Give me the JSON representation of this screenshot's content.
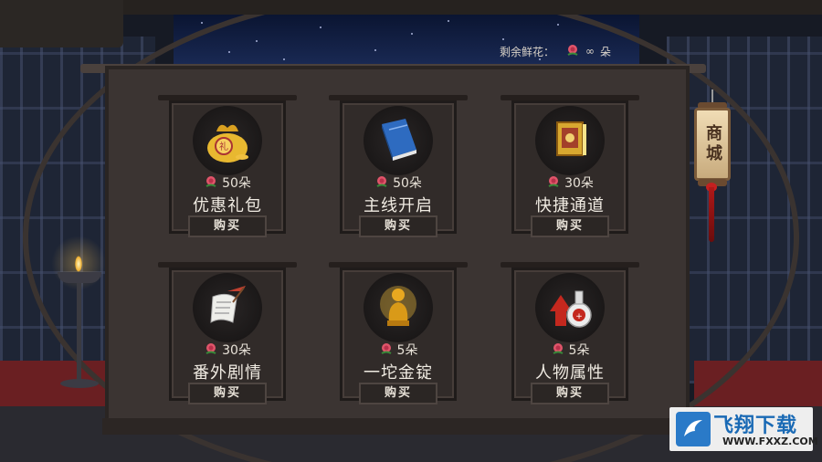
{
  "remaining_flowers": {
    "label": "剩余鲜花：",
    "value": "∞",
    "unit": "朵"
  },
  "shop_sign": "商城",
  "items": [
    {
      "icon": "gift-bag-icon",
      "price": "50朵",
      "name": "优惠礼包",
      "buy_label": "购买"
    },
    {
      "icon": "blue-book-icon",
      "price": "50朵",
      "name": "主线开启",
      "buy_label": "购买"
    },
    {
      "icon": "golden-tome-icon",
      "price": "30朵",
      "name": "快捷通道",
      "buy_label": "购买"
    },
    {
      "icon": "scroll-quill-icon",
      "price": "30朵",
      "name": "番外剧情",
      "buy_label": "购买"
    },
    {
      "icon": "golden-statue-icon",
      "price": "5朵",
      "name": "一坨金锭",
      "buy_label": "购买"
    },
    {
      "icon": "potion-arrow-icon",
      "price": "5朵",
      "name": "人物属性",
      "buy_label": "购买"
    }
  ],
  "watermark": {
    "text": "飞翔下载",
    "url": "WWW.FXXZ.COM"
  },
  "colors": {
    "panel": "#3b3432",
    "rose": "#e0556a",
    "text": "#f0ebe2"
  }
}
